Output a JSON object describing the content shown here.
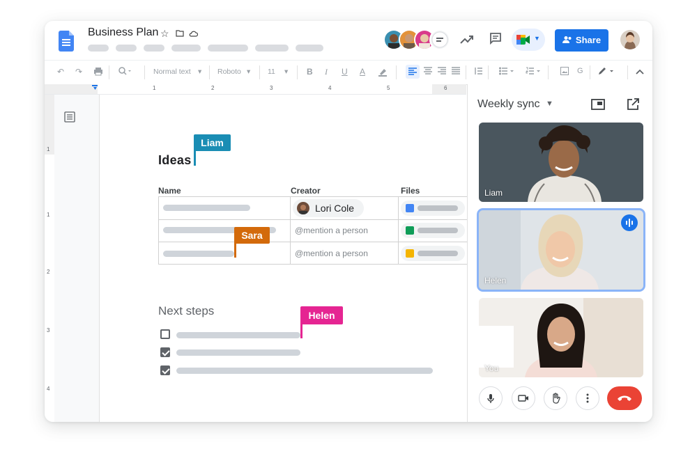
{
  "doc": {
    "title": "Business Plan"
  },
  "toolbar": {
    "style": "Normal text",
    "font": "Roboto",
    "size": "11"
  },
  "ruler": {
    "h_marks": [
      "1",
      "1",
      "2",
      "3",
      "4",
      "5",
      "6"
    ],
    "v_marks": [
      "1",
      "1",
      "2",
      "3",
      "4"
    ]
  },
  "share": {
    "label": "Share"
  },
  "content": {
    "heading_ideas": "Ideas",
    "heading_next": "Next steps",
    "columns": [
      "Name",
      "Creator",
      "Files"
    ],
    "chip_name": "Lori Cole",
    "mention_1": "@mention a person",
    "mention_2": "@mention a person"
  },
  "cursors": {
    "liam": "Liam",
    "sara": "Sara",
    "helen": "Helen"
  },
  "meet": {
    "title": "Weekly sync",
    "tiles": [
      {
        "label": "Liam"
      },
      {
        "label": "Helen"
      },
      {
        "label": "You"
      }
    ]
  },
  "colors": {
    "accent": "#1a73e8",
    "liam": "#1a8db4",
    "sara": "#d36a0b",
    "helen": "#e52592",
    "end_call": "#ea4335"
  }
}
